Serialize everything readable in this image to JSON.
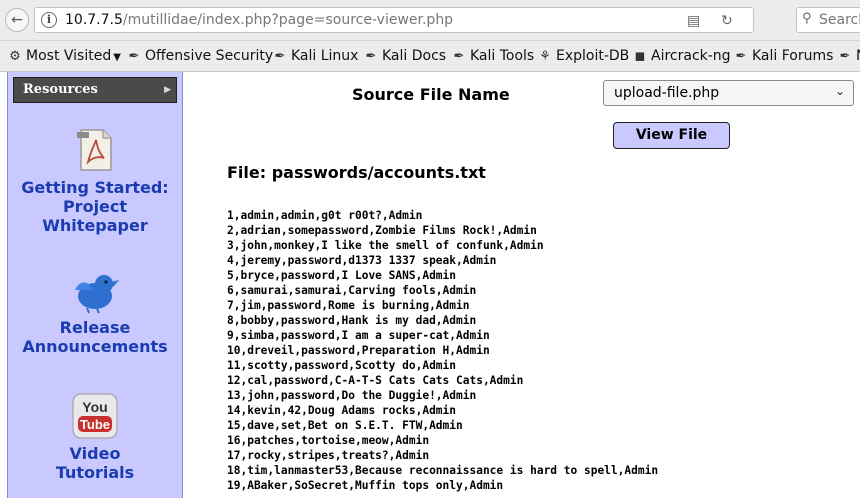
{
  "browser": {
    "url_host": "10.7.7.5",
    "url_path": "/mutillidae/index.php?page=source-viewer.php",
    "search_placeholder": "Search",
    "bookmarks": [
      {
        "label": "Most Visited",
        "icon": "star-icon",
        "has_dropdown": true
      },
      {
        "label": "Offensive Security",
        "icon": "kali-dragon-icon"
      },
      {
        "label": "Kali Linux",
        "icon": "kali-dragon-icon"
      },
      {
        "label": "Kali Docs",
        "icon": "kali-dragon-icon"
      },
      {
        "label": "Kali Tools",
        "icon": "kali-dragon-icon"
      },
      {
        "label": "Exploit-DB",
        "icon": "exploit-db-icon"
      },
      {
        "label": "Aircrack-ng",
        "icon": "aircrack-icon"
      },
      {
        "label": "Kali Forums",
        "icon": "kali-dragon-icon"
      },
      {
        "label": "N",
        "icon": "kali-dragon-icon"
      }
    ]
  },
  "sidebar": {
    "header": "Resources",
    "items": [
      {
        "line1": "Getting Started:",
        "line2": "Project",
        "line3": "Whitepaper",
        "icon": "pdf-document-icon"
      },
      {
        "line1": "Release",
        "line2": "Announcements",
        "icon": "twitter-bird-icon"
      },
      {
        "line1": "Video",
        "line2": "Tutorials",
        "icon": "youtube-icon"
      }
    ]
  },
  "main": {
    "source_file_label": "Source File Name",
    "selected_file": "upload-file.php",
    "view_button": "View File",
    "file_title": "File: passwords/accounts.txt",
    "file_lines": [
      "1,admin,admin,g0t r00t?,Admin",
      "2,adrian,somepassword,Zombie Films Rock!,Admin",
      "3,john,monkey,I like the smell of confunk,Admin",
      "4,jeremy,password,d1373 1337 speak,Admin",
      "5,bryce,password,I Love SANS,Admin",
      "6,samurai,samurai,Carving fools,Admin",
      "7,jim,password,Rome is burning,Admin",
      "8,bobby,password,Hank is my dad,Admin",
      "9,simba,password,I am a super-cat,Admin",
      "10,dreveil,password,Preparation H,Admin",
      "11,scotty,password,Scotty do,Admin",
      "12,cal,password,C-A-T-S Cats Cats Cats,Admin",
      "13,john,password,Do the Duggie!,Admin",
      "14,kevin,42,Doug Adams rocks,Admin",
      "15,dave,set,Bet on S.E.T. FTW,Admin",
      "16,patches,tortoise,meow,Admin",
      "17,rocky,stripes,treats?,Admin",
      "18,tim,lanmaster53,Because reconnaissance is hard to spell,Admin",
      "19,ABaker,SoSecret,Muffin tops only,Admin"
    ]
  },
  "colors": {
    "sidebar_bg": "#c9c9ff",
    "link": "#1a3cb0",
    "button_bg": "#c9c9ff",
    "header_bg": "#4a4a4a"
  }
}
